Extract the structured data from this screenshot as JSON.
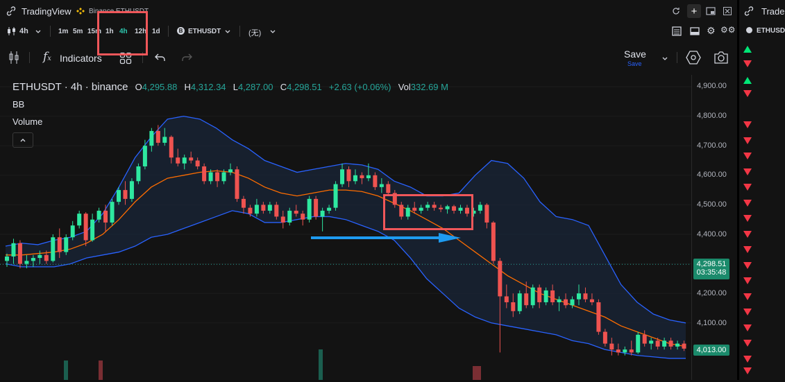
{
  "window": {
    "title": "TradingView",
    "tab_subtitle": "Binance ETHUSDT",
    "new_tab": "+"
  },
  "toolbar": {
    "interval": "4h",
    "timeframes": [
      "1m",
      "5m",
      "15m",
      "1h",
      "4h",
      "12h",
      "1d"
    ],
    "active_timeframe": "4h",
    "symbol": "ETHUSDT",
    "compare": "(无)"
  },
  "drawing_bar": {
    "indicators_label": "Indicators",
    "save_label": "Save",
    "save_sub": "Save"
  },
  "legend": {
    "symbol_line": "ETHUSDT · 4h · binance",
    "o_label": "O",
    "o_value": "4,295.88",
    "h_label": "H",
    "h_value": "4,312.34",
    "l_label": "L",
    "l_value": "4,287.00",
    "c_label": "C",
    "c_value": "4,298.51",
    "change": "+2.63 (+0.06%)",
    "vol_label": "Vol",
    "vol_value": "332.69 M",
    "indicator_bb": "BB",
    "indicator_volume": "Volume",
    "collapse_icon": "chevron-up-icon"
  },
  "price_axis": {
    "ticks": [
      "4,900.00",
      "4,800.00",
      "4,700.00",
      "4,600.00",
      "4,500.00",
      "4,400.00",
      "4,200.00",
      "4,100.00"
    ],
    "current_price": "4,298.51",
    "countdown": "03:35:48",
    "secondary_price": "4,013.00"
  },
  "chart_data": {
    "type": "candlestick",
    "ylim": [
      3990,
      4930
    ],
    "candles": [
      {
        "o": 4310,
        "h": 4335,
        "l": 4290,
        "c": 4325
      },
      {
        "o": 4325,
        "h": 4385,
        "l": 4300,
        "c": 4370
      },
      {
        "o": 4370,
        "h": 4380,
        "l": 4285,
        "c": 4300
      },
      {
        "o": 4300,
        "h": 4330,
        "l": 4285,
        "c": 4310
      },
      {
        "o": 4310,
        "h": 4330,
        "l": 4290,
        "c": 4320
      },
      {
        "o": 4320,
        "h": 4345,
        "l": 4300,
        "c": 4330
      },
      {
        "o": 4330,
        "h": 4345,
        "l": 4300,
        "c": 4310
      },
      {
        "o": 4310,
        "h": 4400,
        "l": 4305,
        "c": 4390
      },
      {
        "o": 4390,
        "h": 4420,
        "l": 4320,
        "c": 4340
      },
      {
        "o": 4340,
        "h": 4400,
        "l": 4330,
        "c": 4390
      },
      {
        "o": 4390,
        "h": 4445,
        "l": 4380,
        "c": 4430
      },
      {
        "o": 4430,
        "h": 4480,
        "l": 4420,
        "c": 4470
      },
      {
        "o": 4470,
        "h": 4475,
        "l": 4360,
        "c": 4380
      },
      {
        "o": 4380,
        "h": 4470,
        "l": 4375,
        "c": 4450
      },
      {
        "o": 4450,
        "h": 4490,
        "l": 4440,
        "c": 4480
      },
      {
        "o": 4480,
        "h": 4500,
        "l": 4410,
        "c": 4440
      },
      {
        "o": 4440,
        "h": 4520,
        "l": 4430,
        "c": 4510
      },
      {
        "o": 4510,
        "h": 4560,
        "l": 4500,
        "c": 4550
      },
      {
        "o": 4550,
        "h": 4580,
        "l": 4500,
        "c": 4520
      },
      {
        "o": 4520,
        "h": 4590,
        "l": 4510,
        "c": 4580
      },
      {
        "o": 4580,
        "h": 4640,
        "l": 4570,
        "c": 4630
      },
      {
        "o": 4630,
        "h": 4720,
        "l": 4620,
        "c": 4700
      },
      {
        "o": 4700,
        "h": 4760,
        "l": 4680,
        "c": 4750
      },
      {
        "o": 4750,
        "h": 4770,
        "l": 4700,
        "c": 4710
      },
      {
        "o": 4710,
        "h": 4760,
        "l": 4700,
        "c": 4730
      },
      {
        "o": 4730,
        "h": 4735,
        "l": 4640,
        "c": 4660
      },
      {
        "o": 4660,
        "h": 4690,
        "l": 4630,
        "c": 4640
      },
      {
        "o": 4640,
        "h": 4670,
        "l": 4620,
        "c": 4660
      },
      {
        "o": 4660,
        "h": 4680,
        "l": 4640,
        "c": 4650
      },
      {
        "o": 4650,
        "h": 4660,
        "l": 4620,
        "c": 4630
      },
      {
        "o": 4630,
        "h": 4640,
        "l": 4570,
        "c": 4580
      },
      {
        "o": 4580,
        "h": 4620,
        "l": 4570,
        "c": 4610
      },
      {
        "o": 4610,
        "h": 4620,
        "l": 4560,
        "c": 4580
      },
      {
        "o": 4580,
        "h": 4620,
        "l": 4570,
        "c": 4610
      },
      {
        "o": 4610,
        "h": 4640,
        "l": 4600,
        "c": 4620
      },
      {
        "o": 4620,
        "h": 4630,
        "l": 4510,
        "c": 4520
      },
      {
        "o": 4520,
        "h": 4530,
        "l": 4470,
        "c": 4490
      },
      {
        "o": 4490,
        "h": 4500,
        "l": 4460,
        "c": 4470
      },
      {
        "o": 4470,
        "h": 4520,
        "l": 4460,
        "c": 4500
      },
      {
        "o": 4500,
        "h": 4510,
        "l": 4470,
        "c": 4480
      },
      {
        "o": 4480,
        "h": 4510,
        "l": 4470,
        "c": 4500
      },
      {
        "o": 4500,
        "h": 4510,
        "l": 4450,
        "c": 4460
      },
      {
        "o": 4460,
        "h": 4480,
        "l": 4420,
        "c": 4440
      },
      {
        "o": 4440,
        "h": 4490,
        "l": 4430,
        "c": 4480
      },
      {
        "o": 4480,
        "h": 4500,
        "l": 4460,
        "c": 4470
      },
      {
        "o": 4470,
        "h": 4480,
        "l": 4430,
        "c": 4450
      },
      {
        "o": 4450,
        "h": 4530,
        "l": 4440,
        "c": 4520
      },
      {
        "o": 4520,
        "h": 4530,
        "l": 4450,
        "c": 4460
      },
      {
        "o": 4460,
        "h": 4490,
        "l": 4410,
        "c": 4480
      },
      {
        "o": 4480,
        "h": 4500,
        "l": 4470,
        "c": 4490
      },
      {
        "o": 4490,
        "h": 4580,
        "l": 4480,
        "c": 4570
      },
      {
        "o": 4570,
        "h": 4640,
        "l": 4560,
        "c": 4620
      },
      {
        "o": 4620,
        "h": 4630,
        "l": 4560,
        "c": 4580
      },
      {
        "o": 4580,
        "h": 4620,
        "l": 4570,
        "c": 4600
      },
      {
        "o": 4600,
        "h": 4610,
        "l": 4570,
        "c": 4590
      },
      {
        "o": 4590,
        "h": 4640,
        "l": 4580,
        "c": 4600
      },
      {
        "o": 4600,
        "h": 4610,
        "l": 4550,
        "c": 4560
      },
      {
        "o": 4560,
        "h": 4590,
        "l": 4540,
        "c": 4570
      },
      {
        "o": 4570,
        "h": 4580,
        "l": 4530,
        "c": 4540
      },
      {
        "o": 4540,
        "h": 4550,
        "l": 4490,
        "c": 4500
      },
      {
        "o": 4500,
        "h": 4510,
        "l": 4450,
        "c": 4460
      },
      {
        "o": 4460,
        "h": 4500,
        "l": 4450,
        "c": 4490
      },
      {
        "o": 4490,
        "h": 4510,
        "l": 4470,
        "c": 4480
      },
      {
        "o": 4480,
        "h": 4500,
        "l": 4470,
        "c": 4490
      },
      {
        "o": 4490,
        "h": 4510,
        "l": 4480,
        "c": 4500
      },
      {
        "o": 4500,
        "h": 4510,
        "l": 4480,
        "c": 4490
      },
      {
        "o": 4490,
        "h": 4500,
        "l": 4475,
        "c": 4485
      },
      {
        "o": 4485,
        "h": 4500,
        "l": 4470,
        "c": 4495
      },
      {
        "o": 4495,
        "h": 4500,
        "l": 4470,
        "c": 4480
      },
      {
        "o": 4480,
        "h": 4500,
        "l": 4470,
        "c": 4490
      },
      {
        "o": 4490,
        "h": 4500,
        "l": 4460,
        "c": 4470
      },
      {
        "o": 4470,
        "h": 4490,
        "l": 4460,
        "c": 4480
      },
      {
        "o": 4480,
        "h": 4510,
        "l": 4470,
        "c": 4500
      },
      {
        "o": 4500,
        "h": 4505,
        "l": 4420,
        "c": 4440
      },
      {
        "o": 4440,
        "h": 4445,
        "l": 4300,
        "c": 4310
      },
      {
        "o": 4310,
        "h": 4320,
        "l": 4000,
        "c": 4190
      },
      {
        "o": 4190,
        "h": 4230,
        "l": 4150,
        "c": 4170
      },
      {
        "o": 4170,
        "h": 4200,
        "l": 4120,
        "c": 4140
      },
      {
        "o": 4140,
        "h": 4210,
        "l": 4130,
        "c": 4200
      },
      {
        "o": 4200,
        "h": 4240,
        "l": 4150,
        "c": 4160
      },
      {
        "o": 4160,
        "h": 4230,
        "l": 4150,
        "c": 4220
      },
      {
        "o": 4220,
        "h": 4230,
        "l": 4150,
        "c": 4170
      },
      {
        "o": 4170,
        "h": 4220,
        "l": 4160,
        "c": 4210
      },
      {
        "o": 4210,
        "h": 4230,
        "l": 4160,
        "c": 4170
      },
      {
        "o": 4170,
        "h": 4190,
        "l": 4140,
        "c": 4180
      },
      {
        "o": 4180,
        "h": 4200,
        "l": 4150,
        "c": 4160
      },
      {
        "o": 4160,
        "h": 4190,
        "l": 4150,
        "c": 4180
      },
      {
        "o": 4180,
        "h": 4230,
        "l": 4160,
        "c": 4200
      },
      {
        "o": 4200,
        "h": 4220,
        "l": 4170,
        "c": 4180
      },
      {
        "o": 4180,
        "h": 4200,
        "l": 4160,
        "c": 4170
      },
      {
        "o": 4170,
        "h": 4180,
        "l": 4060,
        "c": 4070
      },
      {
        "o": 4070,
        "h": 4080,
        "l": 4020,
        "c": 4030
      },
      {
        "o": 4030,
        "h": 4050,
        "l": 3990,
        "c": 4010
      },
      {
        "o": 4010,
        "h": 4030,
        "l": 3990,
        "c": 4000
      },
      {
        "o": 4000,
        "h": 4020,
        "l": 3990,
        "c": 4010
      },
      {
        "o": 4010,
        "h": 4040,
        "l": 3990,
        "c": 4000
      },
      {
        "o": 4000,
        "h": 4070,
        "l": 3995,
        "c": 4060
      },
      {
        "o": 4060,
        "h": 4075,
        "l": 4020,
        "c": 4030
      },
      {
        "o": 4030,
        "h": 4050,
        "l": 4010,
        "c": 4040
      },
      {
        "o": 4040,
        "h": 4050,
        "l": 4010,
        "c": 4020
      },
      {
        "o": 4020,
        "h": 4050,
        "l": 4010,
        "c": 4040
      },
      {
        "o": 4040,
        "h": 4050,
        "l": 4010,
        "c": 4020
      },
      {
        "o": 4020,
        "h": 4040,
        "l": 4010,
        "c": 4030
      },
      {
        "o": 4030,
        "h": 4040,
        "l": 4005,
        "c": 4013
      }
    ],
    "bb_upper": [
      4360,
      4370,
      4365,
      4380,
      4390,
      4410,
      4470,
      4560,
      4660,
      4730,
      4790,
      4800,
      4790,
      4760,
      4720,
      4690,
      4650,
      4630,
      4610,
      4620,
      4630,
      4640,
      4635,
      4620,
      4580,
      4560,
      4530,
      4530,
      4540,
      4600,
      4650,
      4640,
      4590,
      4510,
      4460,
      4450,
      4430,
      4330,
      4230,
      4170,
      4130,
      4110,
      4100
    ],
    "bb_middle": [
      4330,
      4330,
      4335,
      4340,
      4350,
      4370,
      4400,
      4450,
      4510,
      4560,
      4590,
      4600,
      4610,
      4615,
      4610,
      4590,
      4560,
      4540,
      4530,
      4540,
      4550,
      4550,
      4545,
      4530,
      4505,
      4480,
      4450,
      4420,
      4380,
      4340,
      4300,
      4260,
      4230,
      4200,
      4180,
      4160,
      4140,
      4120,
      4090,
      4070,
      4050,
      4030,
      4020
    ],
    "bb_lower": [
      4300,
      4290,
      4290,
      4290,
      4300,
      4320,
      4330,
      4340,
      4360,
      4390,
      4400,
      4420,
      4440,
      4460,
      4480,
      4470,
      4440,
      4440,
      4450,
      4460,
      4460,
      4450,
      4430,
      4410,
      4380,
      4320,
      4250,
      4200,
      4150,
      4120,
      4100,
      4090,
      4080,
      4070,
      4060,
      4040,
      4030,
      4010,
      4000,
      3990,
      3985,
      3980,
      3980
    ],
    "volumes_visible": true
  },
  "side_panel": {
    "title": "Trade",
    "symbol": "ETHUSDT",
    "signals": [
      "up",
      "down",
      "up",
      "down",
      "down",
      "down",
      "down",
      "down",
      "down",
      "down",
      "down",
      "down",
      "down",
      "down",
      "down",
      "down",
      "down",
      "down",
      "down",
      "down",
      "down",
      "down"
    ]
  },
  "colors": {
    "up": "#26a69a",
    "up_bright": "#00e676",
    "down": "#ef5350",
    "bb_band": "#2962ff",
    "bb_mid": "#ff6d00",
    "highlight": "#f23645",
    "arrow": "#2196f3"
  }
}
